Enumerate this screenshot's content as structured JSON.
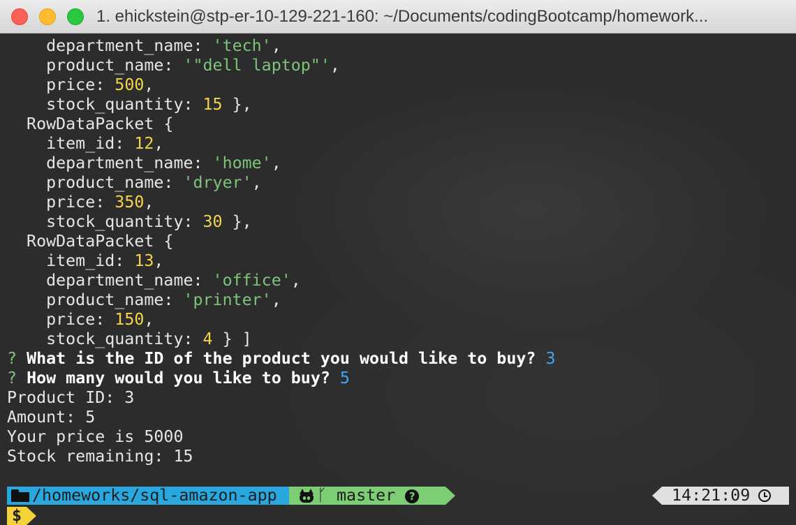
{
  "window": {
    "title": "1. ehickstein@stp-er-10-129-221-160: ~/Documents/codingBootcamp/homework..."
  },
  "terminal": {
    "lines": [
      [
        {
          "t": "    department_name: ",
          "c": "plain"
        },
        {
          "t": "'tech'",
          "c": "str"
        },
        {
          "t": ",",
          "c": "plain"
        }
      ],
      [
        {
          "t": "    product_name: ",
          "c": "plain"
        },
        {
          "t": "'\"dell laptop\"'",
          "c": "str"
        },
        {
          "t": ",",
          "c": "plain"
        }
      ],
      [
        {
          "t": "    price: ",
          "c": "plain"
        },
        {
          "t": "500",
          "c": "num"
        },
        {
          "t": ",",
          "c": "plain"
        }
      ],
      [
        {
          "t": "    stock_quantity: ",
          "c": "plain"
        },
        {
          "t": "15",
          "c": "num"
        },
        {
          "t": " },",
          "c": "plain"
        }
      ],
      [
        {
          "t": "  RowDataPacket {",
          "c": "plain"
        }
      ],
      [
        {
          "t": "    item_id: ",
          "c": "plain"
        },
        {
          "t": "12",
          "c": "num"
        },
        {
          "t": ",",
          "c": "plain"
        }
      ],
      [
        {
          "t": "    department_name: ",
          "c": "plain"
        },
        {
          "t": "'home'",
          "c": "str"
        },
        {
          "t": ",",
          "c": "plain"
        }
      ],
      [
        {
          "t": "    product_name: ",
          "c": "plain"
        },
        {
          "t": "'dryer'",
          "c": "str"
        },
        {
          "t": ",",
          "c": "plain"
        }
      ],
      [
        {
          "t": "    price: ",
          "c": "plain"
        },
        {
          "t": "350",
          "c": "num"
        },
        {
          "t": ",",
          "c": "plain"
        }
      ],
      [
        {
          "t": "    stock_quantity: ",
          "c": "plain"
        },
        {
          "t": "30",
          "c": "num"
        },
        {
          "t": " },",
          "c": "plain"
        }
      ],
      [
        {
          "t": "  RowDataPacket {",
          "c": "plain"
        }
      ],
      [
        {
          "t": "    item_id: ",
          "c": "plain"
        },
        {
          "t": "13",
          "c": "num"
        },
        {
          "t": ",",
          "c": "plain"
        }
      ],
      [
        {
          "t": "    department_name: ",
          "c": "plain"
        },
        {
          "t": "'office'",
          "c": "str"
        },
        {
          "t": ",",
          "c": "plain"
        }
      ],
      [
        {
          "t": "    product_name: ",
          "c": "plain"
        },
        {
          "t": "'printer'",
          "c": "str"
        },
        {
          "t": ",",
          "c": "plain"
        }
      ],
      [
        {
          "t": "    price: ",
          "c": "plain"
        },
        {
          "t": "150",
          "c": "num"
        },
        {
          "t": ",",
          "c": "plain"
        }
      ],
      [
        {
          "t": "    stock_quantity: ",
          "c": "plain"
        },
        {
          "t": "4",
          "c": "num"
        },
        {
          "t": " } ]",
          "c": "plain"
        }
      ],
      [
        {
          "t": "? ",
          "c": "q"
        },
        {
          "t": "What is the ID of the product you would like to buy? ",
          "c": "bold"
        },
        {
          "t": "3",
          "c": "ans"
        }
      ],
      [
        {
          "t": "? ",
          "c": "q"
        },
        {
          "t": "How many would you like to buy? ",
          "c": "bold"
        },
        {
          "t": "5",
          "c": "ans"
        }
      ],
      [
        {
          "t": "Product ID: 3",
          "c": "plain"
        }
      ],
      [
        {
          "t": "Amount: 5",
          "c": "plain"
        }
      ],
      [
        {
          "t": "Your price is 5000",
          "c": "plain"
        }
      ],
      [
        {
          "t": "Stock remaining: 15",
          "c": "plain"
        }
      ]
    ]
  },
  "statusbar": {
    "path": "/homeworks/sql-amazon-app",
    "branch_glyph": "ᚴ",
    "branch": "master",
    "help_glyph": "?",
    "time": "14:21:09",
    "prompt": "$"
  },
  "colors": {
    "string": "#7dc47a",
    "number": "#f5d34a",
    "answer": "#42a5f5",
    "path_segment": "#29a8e0",
    "git_segment": "#7ccd73",
    "time_segment": "#e0e0e0",
    "prompt_segment": "#f3d23a"
  },
  "icons": {
    "path": "folder-icon",
    "git": "github-octocat-icon",
    "branch": "git-branch-icon",
    "status": "question-circle-icon",
    "time": "clock-icon"
  }
}
